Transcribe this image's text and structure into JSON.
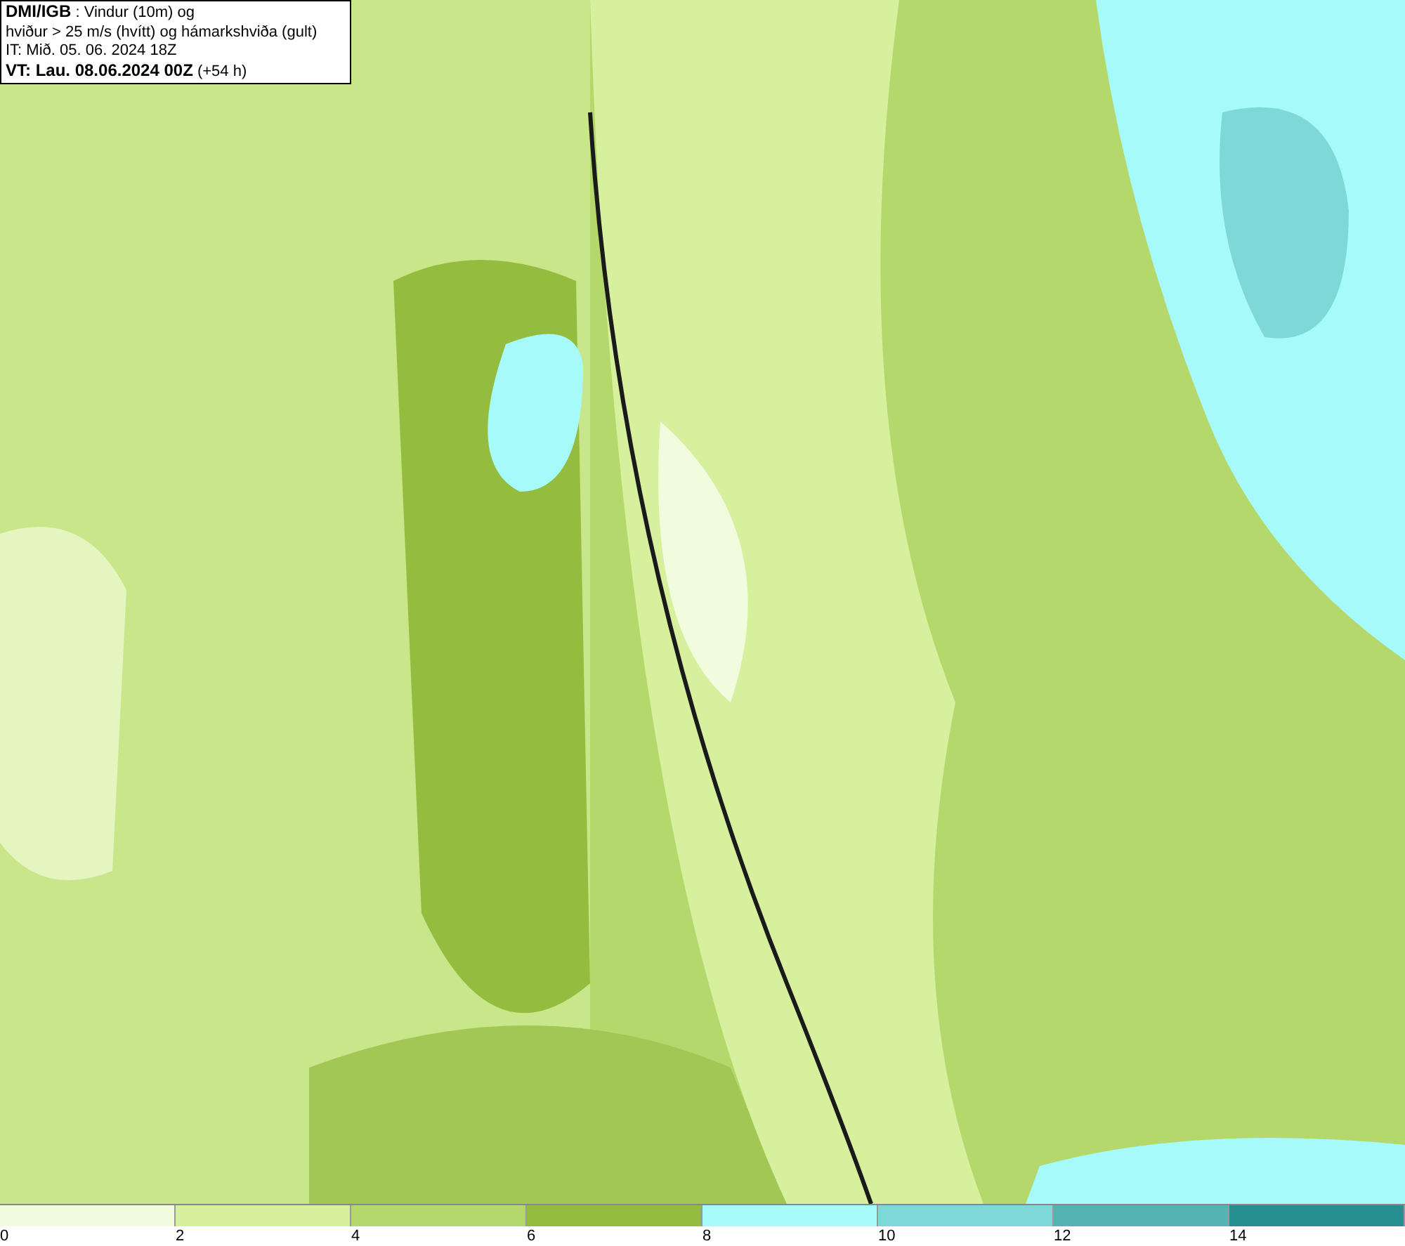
{
  "info_box": {
    "lines": [
      "**DMI/IGB** : Vindur (10m) og",
      "hviður > 25 m/s (hvítt) og hámarkshviða (gult)",
      "IT: Mið. 05. 06. 2024 18Z",
      "**VT: Lau. 08.06.2024 00Z** (+54 h)"
    ]
  },
  "legend": {
    "bins": [
      {
        "color": "#f1fbdd"
      },
      {
        "color": "#d6f09e"
      },
      {
        "color": "#b4d86c"
      },
      {
        "color": "#94bd40"
      },
      {
        "color": "#a6fafa"
      },
      {
        "color": "#7fd8d8"
      },
      {
        "color": "#55b3b3"
      },
      {
        "color": "#268f8f"
      }
    ],
    "ticks": [
      "0",
      "2",
      "4",
      "6",
      "8",
      "10",
      "12",
      "14"
    ]
  }
}
